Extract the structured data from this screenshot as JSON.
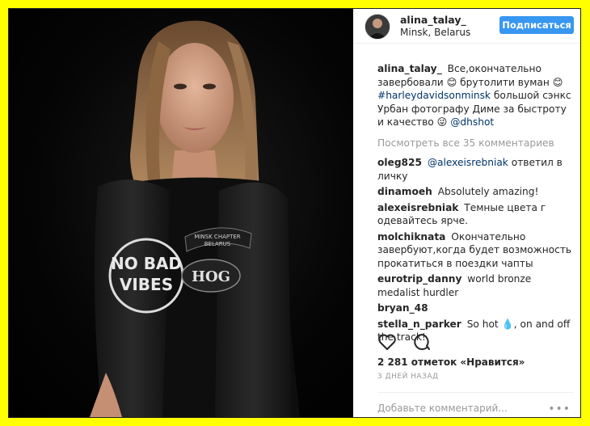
{
  "post": {
    "username": "alina_talay_",
    "location": "Minsk, Belarus",
    "follow_label": "Подписаться"
  },
  "caption": {
    "user": "alina_talay_",
    "text_1": "Все,окончательно завербовали ",
    "emoji_1": "😊",
    "text_2": " брутолити вуман ",
    "emoji_2": "😊",
    "hashtag": "#harleydavidsonminsk",
    "text_3": " большой сэнкс Урбан фотографу Диме за быстроту и качество ",
    "emoji_3": "😜",
    "mention": "@dhshot"
  },
  "view_all": "Посмотреть все 35 комментариев",
  "comments": [
    {
      "user": "oleg825",
      "mention": "@alexeisrebniak",
      "text": " ответил в личку"
    },
    {
      "user": "dinamoeh",
      "text": "Absolutely amazing!"
    },
    {
      "user": "alexeisrebniak",
      "text": "Темные цвета г одевайтесь ярче."
    },
    {
      "user": "molchiknata",
      "text": "Окончательно завербуют,когда будет возможность прокатиться в поездки чапты"
    },
    {
      "user": "eurotrip_danny",
      "text": "world bronze medalist hurdler"
    },
    {
      "user": "bryan_48",
      "text": ""
    },
    {
      "user": "stella_n_parker",
      "text_a": "So hot ",
      "emoji": "💧",
      "text_b": ", on and off the track!"
    }
  ],
  "likes": "2 281 отметок «Нравится»",
  "time_ago": "3 ДНЕЙ НАЗАД",
  "add_comment_placeholder": "Добавьте комментарий...",
  "more_label": "•••",
  "photo": {
    "patch_text_1": "MINSK CHAPTER",
    "patch_text_2": "BELARUS",
    "logo_text": "HOG",
    "shirt_text_1": "NO BAD",
    "shirt_text_2": "VIBES"
  },
  "colors": {
    "background": "#ffff00",
    "follow_button": "#3897f0",
    "link": "#003569"
  }
}
